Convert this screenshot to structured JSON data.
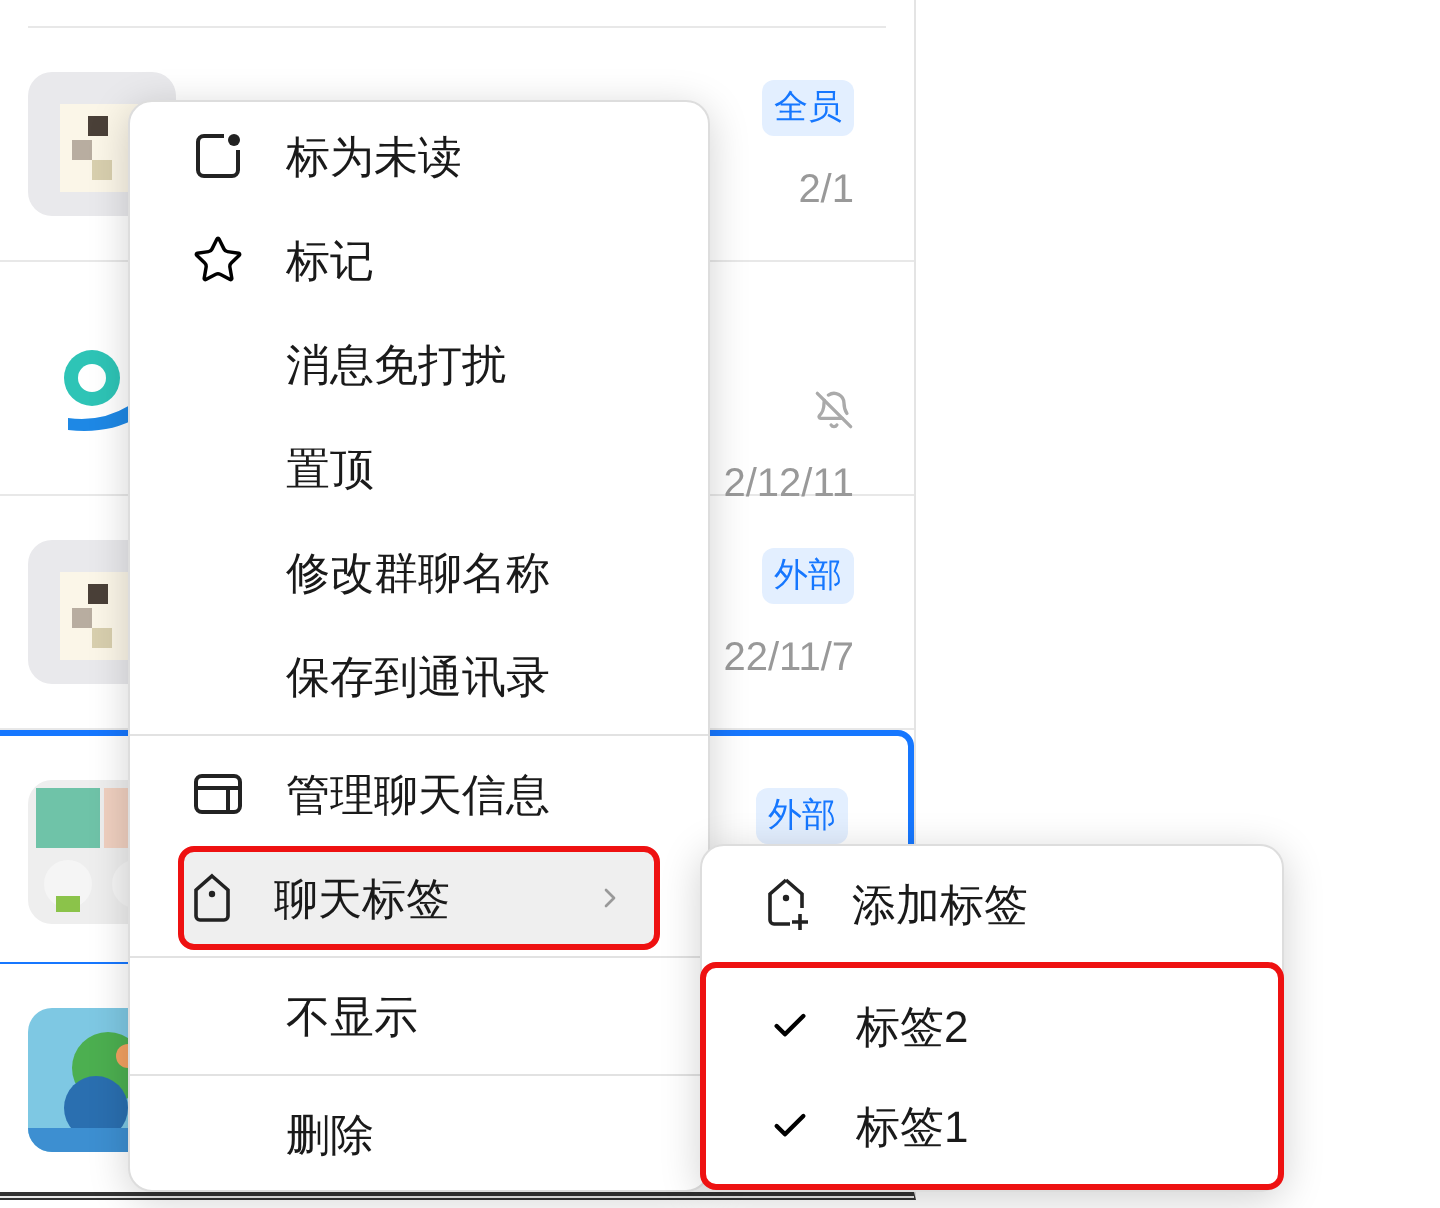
{
  "chat_list": [
    {
      "badge": "全员",
      "date": "2/1",
      "muted": false,
      "selected": false
    },
    {
      "date": "2/12/11",
      "muted": true,
      "selected": false
    },
    {
      "badge": "外部",
      "date": "22/11/7",
      "muted": false,
      "selected": false
    },
    {
      "badge": "外部",
      "muted": false,
      "selected": true
    },
    {
      "muted": false,
      "selected": false
    }
  ],
  "context_menu": {
    "items": [
      {
        "kind": "unread",
        "label": "标为未读"
      },
      {
        "kind": "star",
        "label": "标记"
      },
      {
        "kind": "plain",
        "label": "消息免打扰"
      },
      {
        "kind": "plain",
        "label": "置顶"
      },
      {
        "kind": "plain",
        "label": "修改群聊名称"
      },
      {
        "kind": "plain",
        "label": "保存到通讯录"
      },
      {
        "kind": "divider"
      },
      {
        "kind": "panel",
        "label": "管理聊天信息"
      },
      {
        "kind": "tag",
        "label": "聊天标签",
        "highlighted": true,
        "submenu": true
      },
      {
        "kind": "divider"
      },
      {
        "kind": "plain",
        "label": "不显示"
      },
      {
        "kind": "divider"
      },
      {
        "kind": "plain",
        "label": "删除"
      }
    ]
  },
  "tag_submenu": {
    "add": {
      "label": "添加标签"
    },
    "group_highlighted": true,
    "tags": [
      {
        "label": "标签2",
        "checked": true
      },
      {
        "label": "标签1",
        "checked": true
      }
    ]
  }
}
